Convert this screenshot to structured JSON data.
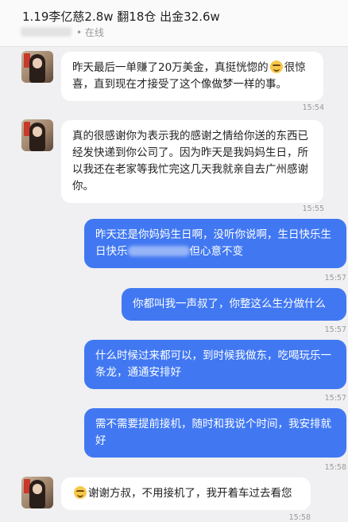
{
  "header": {
    "title": "1.19李亿慈2.8w 翻18仓 出金32.6w",
    "status": "• 在线"
  },
  "messages": [
    {
      "text_a": "昨天最后一单赚了20万美金，真挺恍惚的",
      "text_b": "很惊喜，直到现在才接受了这个像做梦一样的事。",
      "time": "15:54"
    },
    {
      "text": "真的很感谢你为表示我的感谢之情给你送的东西已经发快递到你公司了。因为昨天是我妈妈生日，所以我还在老家等我忙完这几天我就亲自去广州感谢你。",
      "time": "15:55"
    },
    {
      "text_a": "昨天还是你妈妈生日啊，没听你说啊，生日快乐生日快乐",
      "text_b": "但心意不变",
      "time": "15:57"
    },
    {
      "text": "你都叫我一声叔了，你整这么生分做什么",
      "time": "15:57"
    },
    {
      "text": "什么时候过来都可以，到时候我做东，吃喝玩乐一条龙，通通安排好",
      "time": "15:57"
    },
    {
      "text": "需不需要提前接机，随时和我说个时间，我安排就好",
      "time": "15:58"
    },
    {
      "text": "谢谢方叔，不用接机了，我开着车过去看您",
      "time": "15:58"
    }
  ],
  "icons": {
    "emoji": "grinning-sweat-emoji"
  },
  "colors": {
    "outgoing": "#4178f2",
    "incoming": "#ffffff",
    "background": "#f0f0f2"
  }
}
